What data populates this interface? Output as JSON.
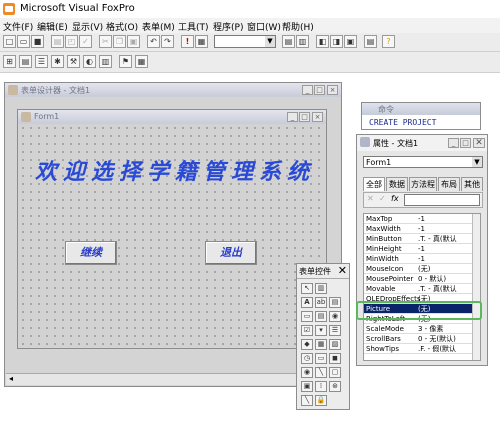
{
  "app": {
    "title": "Microsoft Visual FoxPro"
  },
  "menu": [
    "文件(F)",
    "编辑(E)",
    "显示(V)",
    "格式(O)",
    "表单(M)",
    "工具(T)",
    "程序(P)",
    "窗口(W)",
    "帮助(H)"
  ],
  "toolbar": {
    "combo_value": ""
  },
  "form_designer": {
    "title": "表单设计器 - 文档1",
    "form_title": "Form1",
    "headline": "欢迎选择学籍管理系统",
    "continue_label": "继续",
    "exit_label": "退出"
  },
  "command_window": {
    "title": "命令",
    "command": "CREATE PROJECT"
  },
  "properties": {
    "title": "属性 - 文档1",
    "object": "Form1",
    "tabs": [
      "全部",
      "数据",
      "方法程",
      "布局",
      "其他"
    ],
    "rows": [
      {
        "name": "MaxTop",
        "value": "-1"
      },
      {
        "name": "MaxWidth",
        "value": "-1"
      },
      {
        "name": "MinButton",
        "value": ".T. - 真(默认"
      },
      {
        "name": "MinHeight",
        "value": "-1"
      },
      {
        "name": "MinWidth",
        "value": "-1"
      },
      {
        "name": "MouseIcon",
        "value": "(无)"
      },
      {
        "name": "MousePointer",
        "value": "0 - 默认)"
      },
      {
        "name": "Movable",
        "value": ".T. - 真(默认"
      },
      {
        "name": "OLEDropEffects",
        "value": "(无)"
      },
      {
        "name": "Picture",
        "value": "(无)"
      },
      {
        "name": "RightToLeft",
        "value": "(无)"
      },
      {
        "name": "ScaleMode",
        "value": "3 - 像素"
      },
      {
        "name": "ScrollBars",
        "value": "0 - 无(默认)"
      },
      {
        "name": "ShowTips",
        "value": ".F. - 假(默认"
      }
    ],
    "highlighted_row": "Picture",
    "highlight_color": "#5cb85c"
  },
  "controls_toolbar": {
    "title": "表单控件"
  },
  "colors": {
    "headline": "#2a4ad6",
    "grid_bg": "#d2d2d2",
    "accent": "#0a246a"
  }
}
